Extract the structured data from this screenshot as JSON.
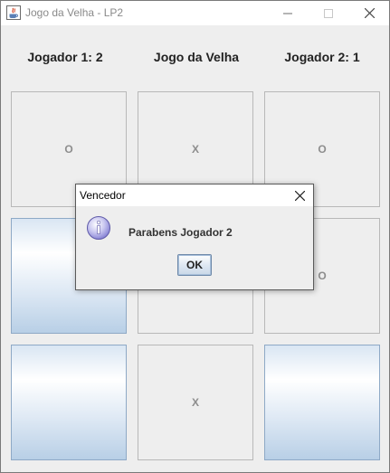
{
  "window": {
    "title": "Jogo da Velha - LP2"
  },
  "header": {
    "player1": "Jogador 1: 2",
    "game_title": "Jogo da Velha",
    "player2": "Jogador 2: 1"
  },
  "board": {
    "cells": [
      "O",
      "X",
      "O",
      "",
      "",
      "O",
      "",
      "X",
      ""
    ]
  },
  "dialog": {
    "title": "Vencedor",
    "message": "Parabens Jogador 2",
    "ok_label": "OK"
  }
}
